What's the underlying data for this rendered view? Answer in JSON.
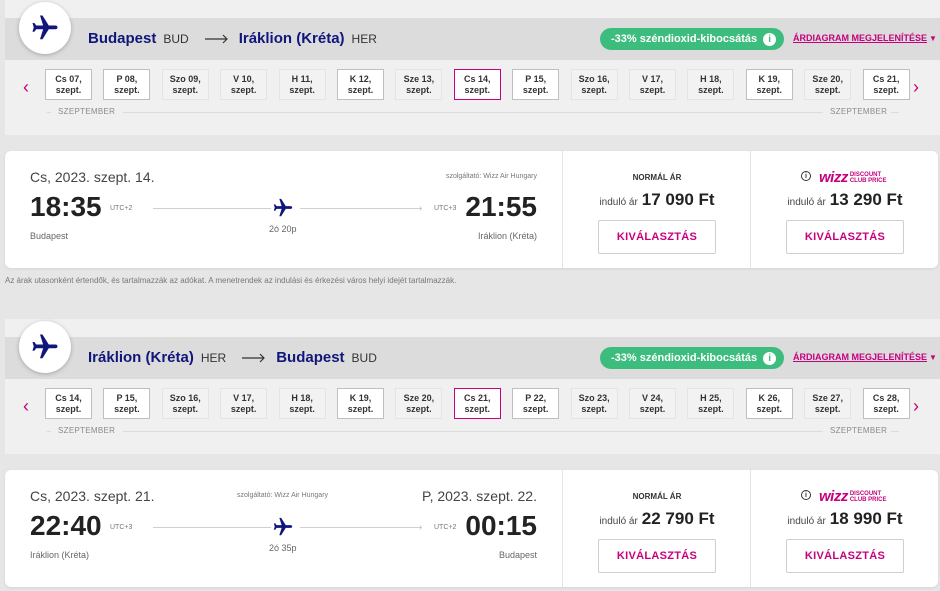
{
  "outbound": {
    "origin": "Budapest",
    "origin_code": "BUD",
    "destination": "Iráklion (Kréta)",
    "destination_code": "HER",
    "co2_badge": "-33% széndioxid-kibocsátás",
    "info_icon": "i",
    "price_diagram_link": "ÁRDIAGRAM MEGJELENÍTÉSE",
    "month_left": "SZEPTEMBER",
    "month_right": "SZEPTEMBER",
    "dates": [
      {
        "day": "Cs 07,",
        "month": "szept.",
        "state": "normal"
      },
      {
        "day": "P 08,",
        "month": "szept.",
        "state": "normal"
      },
      {
        "day": "Szo 09,",
        "month": "szept.",
        "state": "disabled"
      },
      {
        "day": "V 10,",
        "month": "szept.",
        "state": "disabled"
      },
      {
        "day": "H 11,",
        "month": "szept.",
        "state": "disabled"
      },
      {
        "day": "K 12,",
        "month": "szept.",
        "state": "normal"
      },
      {
        "day": "Sze 13,",
        "month": "szept.",
        "state": "disabled"
      },
      {
        "day": "Cs 14,",
        "month": "szept.",
        "state": "selected"
      },
      {
        "day": "P 15,",
        "month": "szept.",
        "state": "normal"
      },
      {
        "day": "Szo 16,",
        "month": "szept.",
        "state": "disabled"
      },
      {
        "day": "V 17,",
        "month": "szept.",
        "state": "disabled"
      },
      {
        "day": "H 18,",
        "month": "szept.",
        "state": "disabled"
      },
      {
        "day": "K 19,",
        "month": "szept.",
        "state": "normal"
      },
      {
        "day": "Sze 20,",
        "month": "szept.",
        "state": "disabled"
      },
      {
        "day": "Cs 21,",
        "month": "szept.",
        "state": "normal"
      }
    ],
    "flight": {
      "date": "Cs, 2023. szept. 14.",
      "operator": "szolgáltató: Wizz Air Hungary",
      "dep_time": "18:35",
      "dep_utc": "UTC+2",
      "arr_time": "21:55",
      "arr_utc": "UTC+3",
      "duration": "2ó 20p",
      "dep_city": "Budapest",
      "arr_city": "Iráklion (Kréta)"
    },
    "fare_normal": {
      "title": "NORMÁL ÁR",
      "from": "induló ár",
      "price": "17 090 Ft",
      "button": "KIVÁLASZTÁS"
    },
    "fare_club": {
      "logo_wizz": "wizz",
      "logo_line1": "DISCOUNT",
      "logo_line2": "CLUB PRICE",
      "info_icon": "i",
      "from": "induló ár",
      "price": "13 290 Ft",
      "button": "KIVÁLASZTÁS"
    }
  },
  "disclaimer": "Az árak utasonként értendők, és tartalmazzák az adókat. A menetrendek az indulási és érkezési város helyi idejét tartalmazzák.",
  "return": {
    "origin": "Iráklion (Kréta)",
    "origin_code": "HER",
    "destination": "Budapest",
    "destination_code": "BUD",
    "co2_badge": "-33% széndioxid-kibocsátás",
    "info_icon": "i",
    "price_diagram_link": "ÁRDIAGRAM MEGJELENÍTÉSE",
    "month_left": "SZEPTEMBER",
    "month_right": "SZEPTEMBER",
    "dates": [
      {
        "day": "Cs 14,",
        "month": "szept.",
        "state": "normal"
      },
      {
        "day": "P 15,",
        "month": "szept.",
        "state": "normal"
      },
      {
        "day": "Szo 16,",
        "month": "szept.",
        "state": "disabled"
      },
      {
        "day": "V 17,",
        "month": "szept.",
        "state": "disabled"
      },
      {
        "day": "H 18,",
        "month": "szept.",
        "state": "disabled"
      },
      {
        "day": "K 19,",
        "month": "szept.",
        "state": "normal"
      },
      {
        "day": "Sze 20,",
        "month": "szept.",
        "state": "disabled"
      },
      {
        "day": "Cs 21,",
        "month": "szept.",
        "state": "selected"
      },
      {
        "day": "P 22,",
        "month": "szept.",
        "state": "normal"
      },
      {
        "day": "Szo 23,",
        "month": "szept.",
        "state": "disabled"
      },
      {
        "day": "V 24,",
        "month": "szept.",
        "state": "disabled"
      },
      {
        "day": "H 25,",
        "month": "szept.",
        "state": "disabled"
      },
      {
        "day": "K 26,",
        "month": "szept.",
        "state": "normal"
      },
      {
        "day": "Sze 27,",
        "month": "szept.",
        "state": "disabled"
      },
      {
        "day": "Cs 28,",
        "month": "szept.",
        "state": "normal"
      }
    ],
    "flight": {
      "date": "Cs, 2023. szept. 21.",
      "arr_date": "P, 2023. szept. 22.",
      "operator": "szolgáltató: Wizz Air Hungary",
      "dep_time": "22:40",
      "dep_utc": "UTC+3",
      "arr_time": "00:15",
      "arr_utc": "UTC+2",
      "duration": "2ó 35p",
      "dep_city": "Iráklion (Kréta)",
      "arr_city": "Budapest"
    },
    "fare_normal": {
      "title": "NORMÁL ÁR",
      "from": "induló ár",
      "price": "22 790 Ft",
      "button": "KIVÁLASZTÁS"
    },
    "fare_club": {
      "logo_wizz": "wizz",
      "logo_line1": "DISCOUNT",
      "logo_line2": "CLUB PRICE",
      "info_icon": "i",
      "from": "induló ár",
      "price": "18 990 Ft",
      "button": "KIVÁLASZTÁS"
    }
  },
  "icons": {
    "plane": "airplane-icon",
    "prev": "chevron-left-icon",
    "next": "chevron-right-icon"
  },
  "colors": {
    "brand_navy": "#11177a",
    "brand_magenta": "#c6007e",
    "co2_green": "#3dbd7d"
  }
}
